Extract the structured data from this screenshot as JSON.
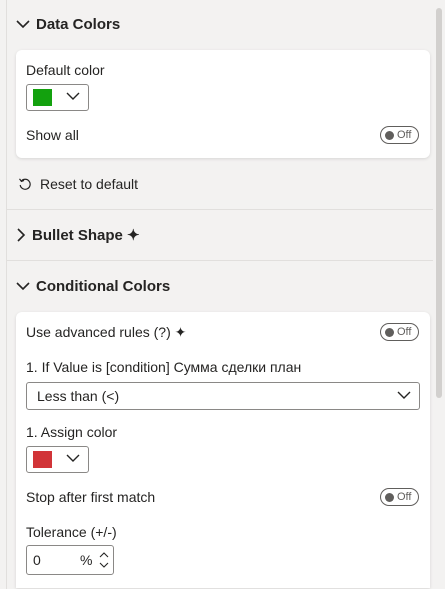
{
  "data_colors": {
    "title": "Data Colors",
    "default_color_label": "Default color",
    "default_color": "#13a10e",
    "show_all_label": "Show all",
    "show_all_state": "Off"
  },
  "reset_label": "Reset to default",
  "bullet_shape": {
    "title": "Bullet Shape ✦"
  },
  "conditional_colors": {
    "title": "Conditional Colors",
    "advanced_rules_label": "Use advanced rules (?) ✦",
    "advanced_rules_state": "Off",
    "condition_label": "1. If Value is [condition] Сумма сделки план",
    "condition_value": "Less than (<)",
    "assign_color_label": "1. Assign color",
    "assign_color": "#d13438",
    "stop_label": "Stop after first match",
    "stop_state": "Off",
    "tolerance_label": "Tolerance (+/-)",
    "tolerance_value": "0",
    "tolerance_unit": "%"
  }
}
